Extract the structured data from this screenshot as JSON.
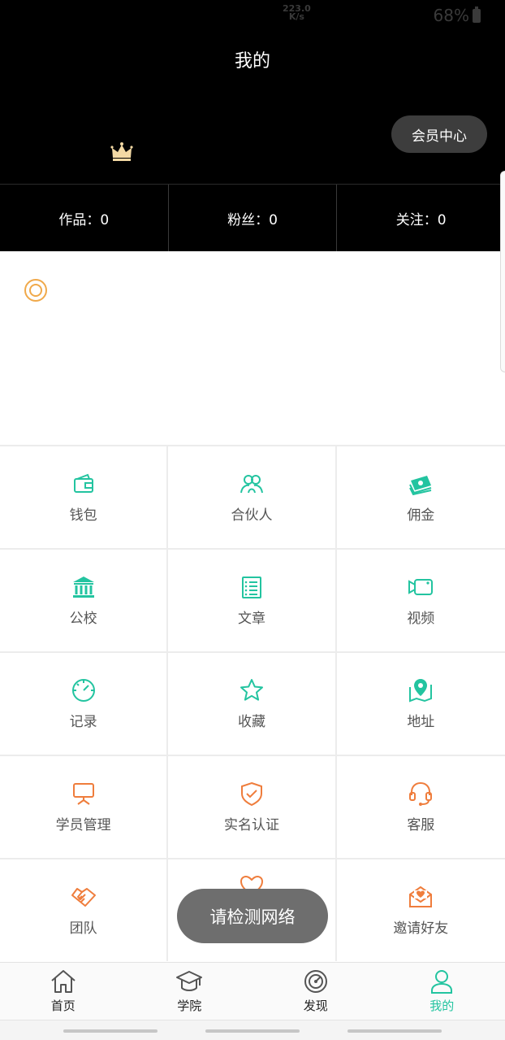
{
  "status_bar": {
    "speed_value": "223.0",
    "speed_unit": "K/s",
    "battery": "68%"
  },
  "header": {
    "title": "我的",
    "member_center_label": "会员中心",
    "crown_icon": "crown-icon"
  },
  "stats": [
    {
      "label": "作品：0"
    },
    {
      "label": "粉丝：0"
    },
    {
      "label": "关注：0"
    }
  ],
  "profile": {
    "icon": "target-icon"
  },
  "colors": {
    "green": "#23c4a0",
    "orange": "#ef7d3c",
    "header_bg": "#000000"
  },
  "grid": [
    [
      {
        "label": "钱包",
        "icon": "wallet-icon"
      },
      {
        "label": "合伙人",
        "icon": "partners-icon"
      },
      {
        "label": "佣金",
        "icon": "money-icon"
      }
    ],
    [
      {
        "label": "公校",
        "icon": "bank-icon"
      },
      {
        "label": "文章",
        "icon": "article-icon"
      },
      {
        "label": "视频",
        "icon": "video-icon"
      }
    ],
    [
      {
        "label": "记录",
        "icon": "speedometer-icon"
      },
      {
        "label": "收藏",
        "icon": "star-icon"
      },
      {
        "label": "地址",
        "icon": "map-pin-icon"
      }
    ],
    [
      {
        "label": "学员管理",
        "icon": "presentation-icon"
      },
      {
        "label": "实名认证",
        "icon": "shield-check-icon"
      },
      {
        "label": "客服",
        "icon": "headset-icon"
      }
    ],
    [
      {
        "label": "团队",
        "icon": "handshake-icon"
      },
      {
        "label": "",
        "icon": "heart-icon"
      },
      {
        "label": "邀请好友",
        "icon": "mail-heart-icon"
      }
    ]
  ],
  "toast": {
    "text": "请检测网络"
  },
  "tabbar": [
    {
      "label": "首页",
      "icon": "home-icon"
    },
    {
      "label": "学院",
      "icon": "graduation-cap-icon"
    },
    {
      "label": "发现",
      "icon": "compass-icon"
    },
    {
      "label": "我的",
      "icon": "user-icon",
      "active": true
    }
  ]
}
